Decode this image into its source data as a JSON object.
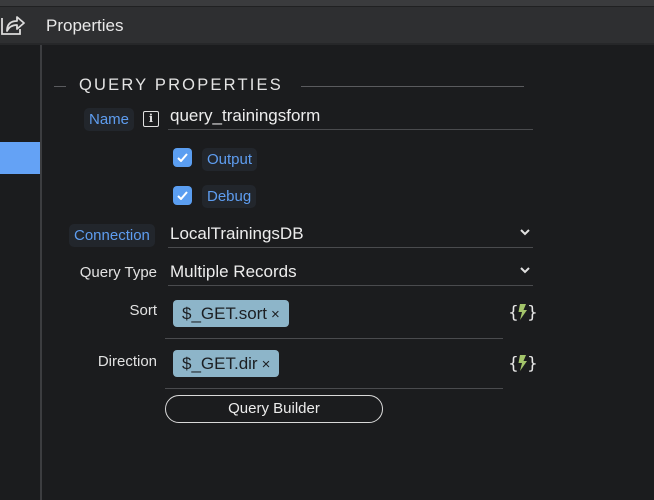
{
  "header": {
    "title": "Properties",
    "icon": "share-arrow-icon"
  },
  "section": {
    "title": "QUERY PROPERTIES"
  },
  "fields": {
    "name": {
      "label": "Name",
      "value": "query_trainingsform",
      "info_icon": "i"
    },
    "output": {
      "label": "Output",
      "checked": true
    },
    "debug": {
      "label": "Debug",
      "checked": true
    },
    "connection": {
      "label": "Connection",
      "value": "LocalTrainingsDB"
    },
    "query_type": {
      "label": "Query Type",
      "value": "Multiple Records"
    },
    "sort": {
      "label": "Sort",
      "tag": "$_GET.sort",
      "remove": "×"
    },
    "direction": {
      "label": "Direction",
      "tag": "$_GET.dir",
      "remove": "×"
    }
  },
  "buttons": {
    "query_builder": "Query Builder"
  },
  "colors": {
    "accent": "#5e9df0",
    "checkbox": "#5b9ef1",
    "tag_bg": "#8db5c9",
    "dynamic_icon": "#a3c46a",
    "background": "#1b1c1e",
    "header_bg": "#2e2f31"
  }
}
